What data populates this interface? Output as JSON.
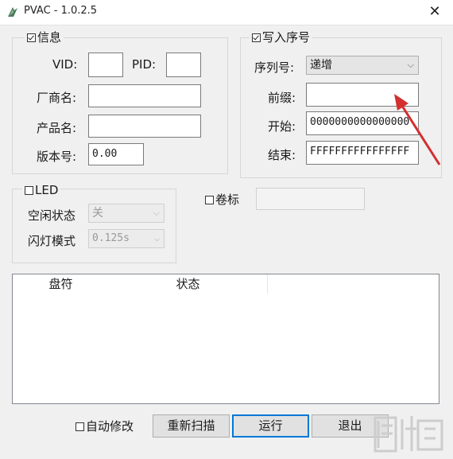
{
  "window": {
    "title": "PVAC - 1.0.2.5",
    "close_glyph": "✕"
  },
  "info": {
    "legend": "信息",
    "checked": true,
    "vid_label": "VID:",
    "vid_value": "",
    "pid_label": "PID:",
    "pid_value": "",
    "vendor_label": "厂商名:",
    "vendor_value": "",
    "product_label": "产品名:",
    "product_value": "",
    "version_label": "版本号:",
    "version_value": "0.00"
  },
  "serial": {
    "legend": "写入序号",
    "checked": true,
    "mode_label": "序列号:",
    "mode_value": "递增",
    "prefix_label": "前缀:",
    "prefix_value": "",
    "start_label": "开始:",
    "start_value": "0000000000000000",
    "end_label": "结束:",
    "end_value": "FFFFFFFFFFFFFFFF"
  },
  "led": {
    "legend": "LED",
    "checked": false,
    "idle_label": "空闲状态",
    "idle_value": "关",
    "blink_label": "闪灯模式",
    "blink_value": "0.125s"
  },
  "volume": {
    "label": "卷标",
    "checked": false,
    "value": ""
  },
  "table": {
    "columns": [
      "盘符",
      "状态"
    ],
    "rows": []
  },
  "footer": {
    "auto_modify_label": "自动修改",
    "auto_modify_checked": false,
    "rescan_label": "重新扫描",
    "run_label": "运行",
    "exit_label": "退出"
  },
  "watermark": {
    "text": "下载吧"
  },
  "colors": {
    "accent": "#0078d7",
    "annotation_arrow": "#d32f2f"
  },
  "icons": {
    "app": "pvac-app-icon",
    "close": "close-icon",
    "chevron": "chevron-down-icon"
  }
}
